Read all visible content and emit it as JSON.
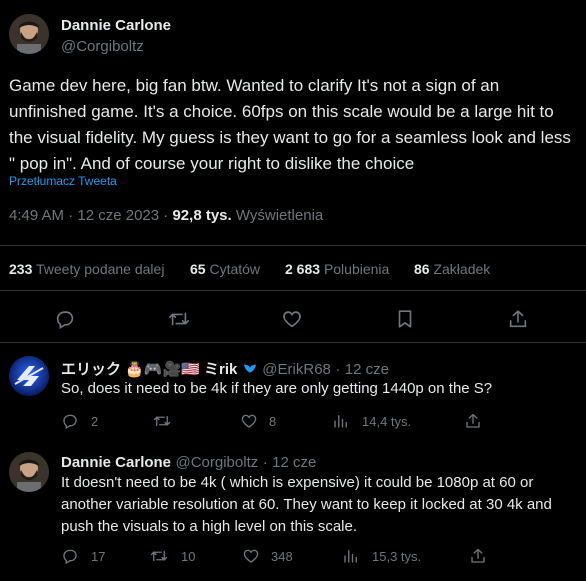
{
  "main_tweet": {
    "author_name": "Dannie Carlone",
    "author_handle": "@Corgiboltz",
    "text": "Game dev here, big fan btw. Wanted to clarify It's not a sign of an unfinished game. It's a choice. 60fps on this scale would be a large hit to the visual fidelity. My guess is they want to go for a seamless look and less \" pop in\". And of course your right to dislike the choice",
    "translate_label": "Przetłumacz Tweeta",
    "time": "4:49 AM",
    "date": "12 cze 2023",
    "views_count": "92,8 tys.",
    "views_label": "Wyświetlenia",
    "sep": "·",
    "stats": {
      "retweets_count": "233",
      "retweets_label": "Tweety podane dalej",
      "quotes_count": "65",
      "quotes_label": "Cytatów",
      "likes_count": "2 683",
      "likes_label": "Polubienia",
      "bookmarks_count": "86",
      "bookmarks_label": "Zakładek"
    }
  },
  "reply_1": {
    "author_name": "エリック 🎂🎮🎥🇺🇸 ミrik",
    "author_handle": "@ErikR68",
    "time": "12 cze",
    "text": "So, does it need to be 4k if they are only getting 1440p on the S?",
    "replies": "2",
    "retweets": "",
    "likes": "8",
    "views": "14,4 tys."
  },
  "reply_2": {
    "author_name": "Dannie Carlone",
    "author_handle": "@Corgiboltz",
    "time": "12 cze",
    "text": "It doesn't need to be 4k ( which is expensive) it could be 1080p at 60 or another variable resolution at 60. They want to keep it locked at 30 4k and push the visuals to a high level on this scale.",
    "replies": "17",
    "retweets": "10",
    "likes": "348",
    "views": "15,3 tys."
  },
  "colors": {
    "background": "#000000",
    "text": "#e7e9ea",
    "muted": "#71767b",
    "link": "#1d9bf0",
    "divider": "#2f3336",
    "verified": "#1d9bf0"
  },
  "icons": [
    "reply-icon",
    "retweet-icon",
    "like-icon",
    "bookmark-icon",
    "share-icon",
    "views-icon",
    "verified-icon"
  ]
}
